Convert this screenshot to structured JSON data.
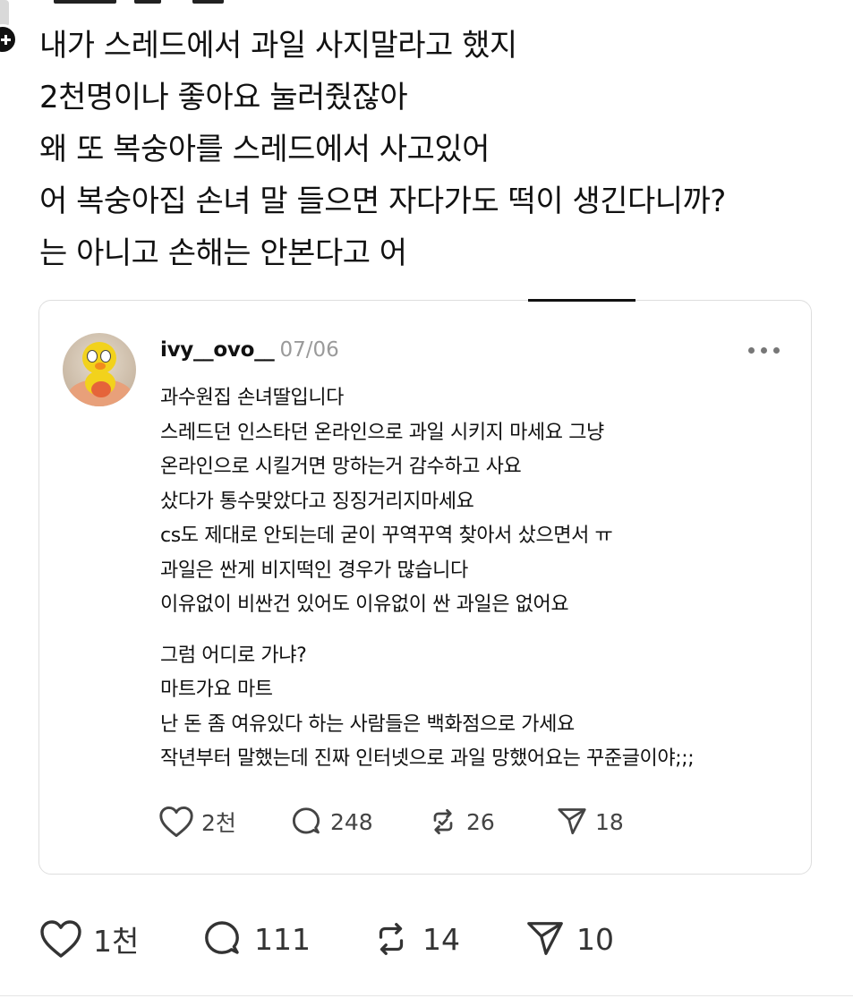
{
  "post": {
    "lines": [
      "내가 스레드에서 과일 사지말라고 했지",
      "2천명이나 좋아요 눌러줬잖아",
      "왜 또 복숭아를 스레드에서 사고있어",
      "어 복숭아집 손녀 말 들으면 자다가도 떡이 생긴다니까?",
      "는 아니고 손해는 안본다고 어"
    ],
    "actions": {
      "likes": "1천",
      "replies": "111",
      "reposts": "14",
      "shares": "10"
    }
  },
  "quoted": {
    "username": "ivy__ovo__",
    "date": "07/06",
    "body": [
      "과수원집 손녀딸입니다",
      "스레드던 인스타던 온라인으로 과일 시키지 마세요 그냥",
      "온라인으로 시킬거면 망하는거 감수하고 사요",
      "샀다가 통수맞았다고 징징거리지마세요",
      "cs도 제대로 안되는데 굳이 꾸역꾸역 찾아서 샀으면서 ㅠ",
      "과일은 싼게 비지떡인 경우가 많습니다",
      "이유없이 비싼건 있어도 이유없이 싼 과일은 없어요"
    ],
    "body2": [
      "그럼 어디로 가냐?",
      "마트가요 마트",
      "난 돈 좀 여유있다 하는 사람들은 백화점으로 가세요",
      "작년부터 말했는데 진짜 인터넷으로 과일 망했어요는 꾸준글이야;;;"
    ],
    "actions": {
      "likes": "2천",
      "replies": "248",
      "reposts": "26",
      "shares": "18"
    }
  },
  "icons": {
    "like": "heart-icon",
    "reply": "speech-bubble-icon",
    "repost": "repost-arrows-icon",
    "share": "paper-plane-icon",
    "more": "more-dots-icon",
    "add": "plus-icon"
  },
  "colors": {
    "text": "#111111",
    "muted": "#9a9a9a",
    "icon": "#444444",
    "border": "#dedede"
  }
}
